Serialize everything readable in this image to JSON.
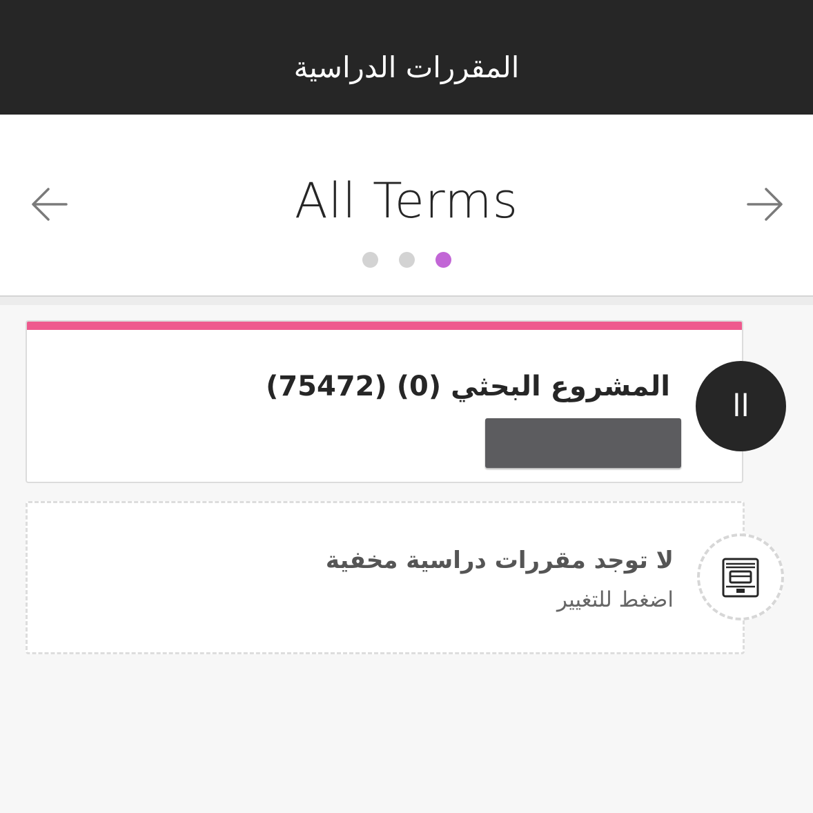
{
  "header": {
    "title": "المقررات الدراسية"
  },
  "term_switcher": {
    "title": "All Terms",
    "prev_icon": "arrow-left-icon",
    "next_icon": "arrow-right-icon",
    "page_count": 3,
    "active_page": 3,
    "active_color": "#c266d6",
    "inactive_color": "#d3d3d3"
  },
  "course": {
    "title": "المشروع البحثي (0) (75472)",
    "accent_color": "#ee5a8e",
    "badge_text": "اا"
  },
  "hidden_courses": {
    "title": "لا توجد مقررات دراسية مخفية",
    "subtitle": "اضغط للتغيير",
    "icon": "course-archive-icon"
  }
}
